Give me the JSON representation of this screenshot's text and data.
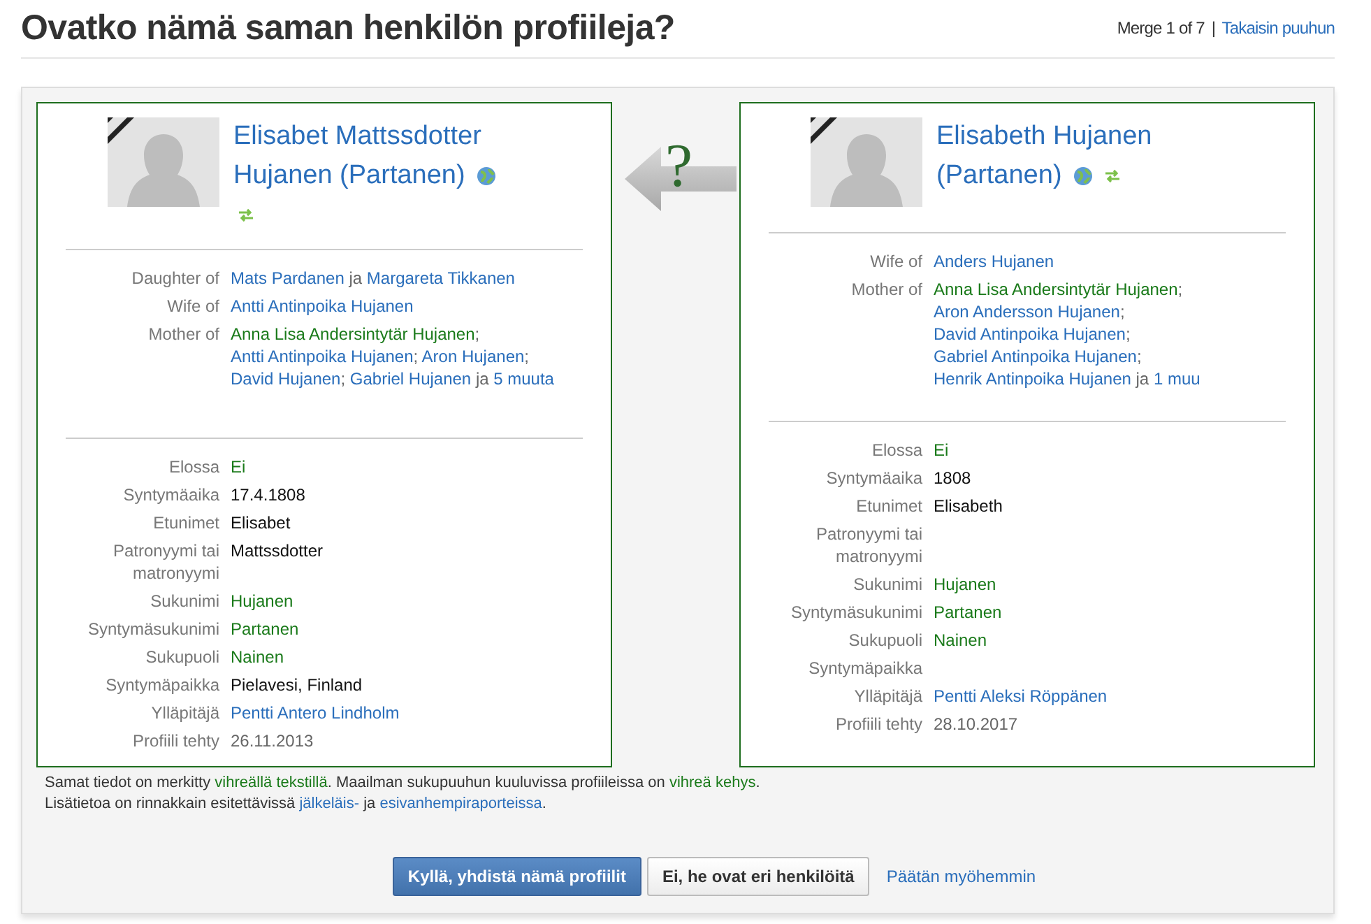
{
  "title": "Ovatko nämä saman henkilön profiileja?",
  "merge_counter": "Merge 1 of 7",
  "separator": "|",
  "back_link": "Takaisin puuhun",
  "profiles": [
    {
      "name": "Elisabet Mattssdotter Hujanen (Partanen)",
      "deceased": true,
      "in_world_tree": true,
      "relations": [
        {
          "label": "Daughter of",
          "segments": [
            {
              "kind": "link",
              "text": "Mats Pardanen"
            },
            {
              "kind": "text",
              "text": " ja "
            },
            {
              "kind": "link",
              "text": "Margareta Tikkanen"
            }
          ]
        },
        {
          "label": "Wife of",
          "segments": [
            {
              "kind": "link",
              "text": "Antti Antinpoika Hujanen"
            }
          ]
        },
        {
          "label": "Mother of",
          "segments": [
            {
              "kind": "match",
              "text": "Anna Lisa Andersintytär Hujanen"
            },
            {
              "kind": "text",
              "text": "; "
            },
            {
              "kind": "link",
              "text": "Antti Antinpoika Hujanen"
            },
            {
              "kind": "text",
              "text": "; "
            },
            {
              "kind": "link",
              "text": "Aron Hujanen"
            },
            {
              "kind": "text",
              "text": "; "
            },
            {
              "kind": "link",
              "text": "David Hujanen"
            },
            {
              "kind": "text",
              "text": "; "
            },
            {
              "kind": "link",
              "text": "Gabriel Hujanen"
            },
            {
              "kind": "text",
              "text": " ja "
            },
            {
              "kind": "link",
              "text": "5 muuta"
            }
          ]
        }
      ],
      "fields": [
        {
          "label": "Elossa",
          "value": "Ei",
          "kind": "match"
        },
        {
          "label": "Syntymäaika",
          "value": "17.4.1808",
          "kind": "plain"
        },
        {
          "label": "Etunimet",
          "value": "Elisabet",
          "kind": "plain"
        },
        {
          "label": "Patronyymi tai matronyymi",
          "value": "Mattssdotter",
          "kind": "plain"
        },
        {
          "label": "Sukunimi",
          "value": "Hujanen",
          "kind": "match"
        },
        {
          "label": "Syntymäsukunimi",
          "value": "Partanen",
          "kind": "match"
        },
        {
          "label": "Sukupuoli",
          "value": "Nainen",
          "kind": "match"
        },
        {
          "label": "Syntymäpaikka",
          "value": "Pielavesi, Finland",
          "kind": "plain"
        },
        {
          "label": "Ylläpitäjä",
          "value": "Pentti Antero Lindholm",
          "kind": "link"
        },
        {
          "label": "Profiili tehty",
          "value": "26.11.2013",
          "kind": "meta"
        }
      ]
    },
    {
      "name": "Elisabeth Hujanen (Partanen)",
      "deceased": true,
      "in_world_tree": true,
      "relations": [
        {
          "label": "Wife of",
          "segments": [
            {
              "kind": "link",
              "text": "Anders Hujanen"
            }
          ]
        },
        {
          "label": "Mother of",
          "segments": [
            {
              "kind": "match",
              "text": "Anna Lisa Andersintytär Hujanen"
            },
            {
              "kind": "text",
              "text": "; "
            },
            {
              "kind": "link",
              "text": "Aron Andersson Hujanen"
            },
            {
              "kind": "text",
              "text": "; "
            },
            {
              "kind": "link",
              "text": "David Antinpoika Hujanen"
            },
            {
              "kind": "text",
              "text": "; "
            },
            {
              "kind": "link",
              "text": "Gabriel Antinpoika Hujanen"
            },
            {
              "kind": "text",
              "text": "; "
            },
            {
              "kind": "link",
              "text": "Henrik Antinpoika Hujanen"
            },
            {
              "kind": "text",
              "text": " ja "
            },
            {
              "kind": "link",
              "text": "1 muu"
            }
          ]
        }
      ],
      "fields": [
        {
          "label": "Elossa",
          "value": "Ei",
          "kind": "match"
        },
        {
          "label": "Syntymäaika",
          "value": "1808",
          "kind": "plain"
        },
        {
          "label": "Etunimet",
          "value": "Elisabeth",
          "kind": "plain"
        },
        {
          "label": "Patronyymi tai matronyymi"
        },
        {
          "label": "Sukunimi",
          "value": "Hujanen",
          "kind": "match"
        },
        {
          "label": "Syntymäsukunimi",
          "value": "Partanen",
          "kind": "match"
        },
        {
          "label": "Sukupuoli",
          "value": "Nainen",
          "kind": "match"
        },
        {
          "label": "Syntymäpaikka"
        },
        {
          "label": "Ylläpitäjä",
          "value": "Pentti Aleksi Röppänen",
          "kind": "link"
        },
        {
          "label": "Profiili tehty",
          "value": "28.10.2017",
          "kind": "meta"
        }
      ]
    }
  ],
  "arrow_mark": "?",
  "notes": [
    [
      {
        "kind": "text",
        "text": "Samat tiedot on merkitty "
      },
      {
        "kind": "match",
        "text": "vihreällä tekstillä"
      },
      {
        "kind": "text",
        "text": ". Maailman sukupuuhun kuuluvissa profiileissa on "
      },
      {
        "kind": "match",
        "text": "vihreä kehys"
      },
      {
        "kind": "text",
        "text": "."
      }
    ],
    [
      {
        "kind": "text",
        "text": "Lisätietoa on rinnakkain esitettävissä "
      },
      {
        "kind": "link",
        "text": "jälkeläis-"
      },
      {
        "kind": "text",
        "text": " ja "
      },
      {
        "kind": "link",
        "text": "esivanhempiraporteissa"
      },
      {
        "kind": "text",
        "text": "."
      }
    ]
  ],
  "buttons": [
    {
      "label": "Kyllä, yhdistä nämä profiilit",
      "kind": "primary"
    },
    {
      "label": "Ei, he ovat eri henkilöitä",
      "kind": "default"
    },
    {
      "label": "Päätän myöhemmin",
      "kind": "link"
    }
  ]
}
